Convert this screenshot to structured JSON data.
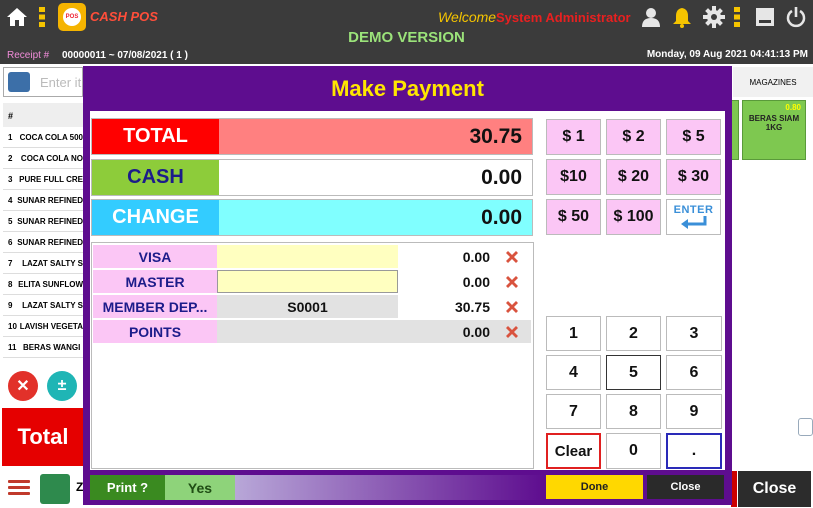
{
  "app": {
    "name": "CASH POS",
    "logo_text": "POS",
    "welcome_label": "Welcome",
    "user_name": "System Administrator",
    "edition": "DEMO VERSION",
    "receipt_label": "Receipt #",
    "receipt_value": "00000011 ~ 07/08/2021 ( 1 )",
    "datetime": "Monday, 09 Aug 2021 04:41:13 PM"
  },
  "background": {
    "search_placeholder": "Enter it",
    "table_header": "#",
    "items": [
      {
        "no": "1",
        "name": "COCA COLA 500"
      },
      {
        "no": "2",
        "name": "COCA COLA NO"
      },
      {
        "no": "3",
        "name": "PURE FULL CRE"
      },
      {
        "no": "4",
        "name": "SUNAR REFINED"
      },
      {
        "no": "5",
        "name": "SUNAR REFINED"
      },
      {
        "no": "6",
        "name": "SUNAR REFINED"
      },
      {
        "no": "7",
        "name": "LAZAT SALTY S"
      },
      {
        "no": "8",
        "name": "ELITA SUNFLOW"
      },
      {
        "no": "9",
        "name": "LAZAT SALTY S"
      },
      {
        "no": "10",
        "name": "LAVISH VEGETA"
      },
      {
        "no": "11",
        "name": "BERAS WANGI"
      }
    ],
    "total_label": "Total",
    "user_initial": "Z",
    "close_label": "Close",
    "category_tab": "MAGAZINES",
    "tile": {
      "price": "0.80",
      "name": "BERAS SIAM 1KG"
    },
    "partial_tile_price": "6"
  },
  "modal": {
    "title": "Make Payment",
    "total": {
      "label": "TOTAL",
      "value": "30.75"
    },
    "cash": {
      "label": "CASH",
      "value": "0.00"
    },
    "change": {
      "label": "CHANGE",
      "value": "0.00"
    },
    "payment_methods": [
      {
        "label": "VISA",
        "ref": "",
        "amount": "0.00"
      },
      {
        "label": "MASTER",
        "ref": "",
        "amount": "0.00"
      },
      {
        "label": "MEMBER DEP...",
        "ref": "S0001",
        "amount": "30.75"
      },
      {
        "label": "POINTS",
        "ref": "",
        "amount": "0.00"
      }
    ],
    "quick_amounts": [
      "$ 1",
      "$ 2",
      "$ 5",
      "$10",
      "$ 20",
      "$ 30",
      "$ 50",
      "$ 100"
    ],
    "enter_label": "ENTER",
    "keypad": [
      "1",
      "2",
      "3",
      "4",
      "5",
      "6",
      "7",
      "8",
      "9",
      "Clear",
      "0",
      "."
    ],
    "print_label": "Print ?",
    "print_value": "Yes",
    "done_label": "Done",
    "close_label": "Close"
  },
  "colors": {
    "modal_bg": "#5e0d8f",
    "title": "#ffe600",
    "total_label": "#ff0000",
    "total_field": "#ff8080",
    "cash_label": "#8dcc3a",
    "change_label": "#33ccff",
    "change_field": "#80ffff",
    "method_label": "#fbc6f5",
    "quick_btn": "#fbc6f5",
    "done": "#ffd800"
  }
}
